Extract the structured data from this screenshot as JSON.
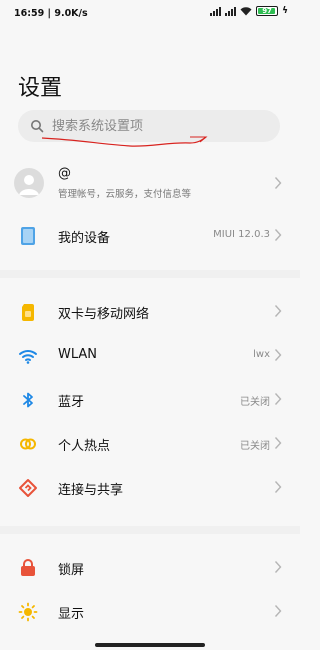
{
  "status": {
    "time": "16:59",
    "speed": "9.0K/s",
    "battery": "97"
  },
  "title": "设置",
  "search": {
    "placeholder": "搜索系统设置项"
  },
  "account": {
    "name": "@",
    "subtitle": "管理帐号，云服务，支付信息等"
  },
  "device": {
    "label": "我的设备",
    "value": "MIUI 12.0.3"
  },
  "network_items": [
    {
      "label": "双卡与移动网络",
      "value": "",
      "icon": "sim-card-icon"
    },
    {
      "label": "WLAN",
      "value": "lwx",
      "icon": "wifi-icon"
    },
    {
      "label": "蓝牙",
      "value": "已关闭",
      "icon": "bluetooth-icon"
    },
    {
      "label": "个人热点",
      "value": "已关闭",
      "icon": "hotspot-icon"
    },
    {
      "label": "连接与共享",
      "value": "",
      "icon": "connection-share-icon"
    }
  ],
  "display_items": [
    {
      "label": "锁屏",
      "icon": "lock-icon"
    },
    {
      "label": "显示",
      "icon": "brightness-icon"
    }
  ],
  "colors": {
    "sim": "#f5b700",
    "wifi": "#1e88e5",
    "bluetooth": "#1e88e5",
    "hotspot": "#f5b700",
    "share": "#e8533a",
    "lock": "#e8533a",
    "display": "#f5b700",
    "scribble": "#d8231f"
  }
}
